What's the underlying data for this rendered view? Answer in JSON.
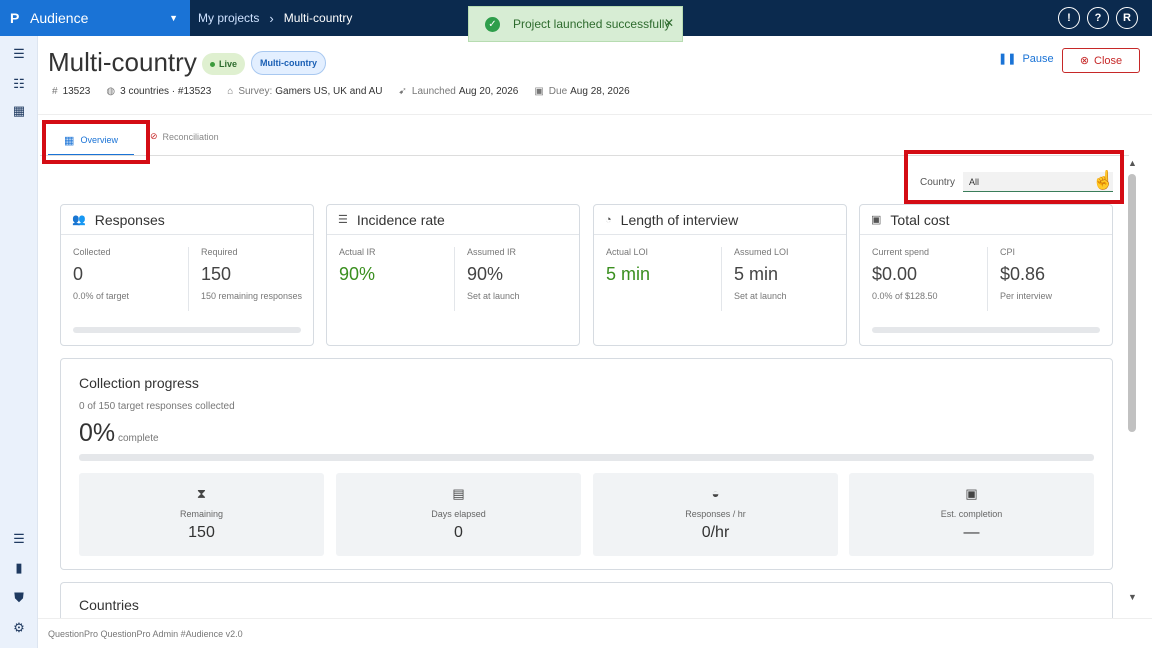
{
  "topbar": {
    "app_logo": "P",
    "app_name": "Audience",
    "breadcrumb": [
      "My projects",
      "Multi-country"
    ],
    "toast": "Project launched successfully",
    "icons": [
      "feedback-icon",
      "help-icon"
    ],
    "avatar_initial": "R"
  },
  "sidebar": {
    "icons": [
      "menu-icon",
      "list-icon",
      "dashboard-icon",
      "sliders-icon",
      "trash-icon",
      "shield-icon",
      "settings-icon"
    ]
  },
  "project": {
    "title": "Multi-country",
    "status": "Live",
    "tag": "Multi-country",
    "pause": "Pause",
    "close": "Close",
    "meta": {
      "id": "13523",
      "countries": "3 countries · #13523",
      "survey_label": "Survey:",
      "survey": "Gamers US, UK and AU",
      "launched_label": "Launched",
      "launched": "Aug 20, 2026",
      "due_label": "Due",
      "due": "Aug 28, 2026"
    }
  },
  "tabs": {
    "overview": "Overview",
    "reconciliation": "Reconciliation"
  },
  "filter": {
    "label": "Country",
    "value": "All"
  },
  "cards": {
    "responses": {
      "title": "Responses",
      "l_label": "Collected",
      "l_value": "0",
      "l_sub": "0.0% of target",
      "r_label": "Required",
      "r_value": "150",
      "r_sub": "150 remaining responses",
      "progress": 0
    },
    "incidence": {
      "title": "Incidence rate",
      "l_label": "Actual IR",
      "l_value": "90%",
      "r_label": "Assumed IR",
      "r_value": "90%",
      "r_sub": "Set at launch"
    },
    "loi": {
      "title": "Length of interview",
      "l_label": "Actual LOI",
      "l_value": "5 min",
      "r_label": "Assumed LOI",
      "r_value": "5 min",
      "r_sub": "Set at launch"
    },
    "cost": {
      "title": "Total cost",
      "l_label": "Current spend",
      "l_value": "$0.00",
      "l_sub": "0.0% of $128.50",
      "r_label": "CPI",
      "r_value": "$0.86",
      "r_sub": "Per interview",
      "progress": 0
    }
  },
  "collection": {
    "title": "Collection progress",
    "subtitle": "0 of 150 target responses collected",
    "percent": "0%",
    "complete": "complete",
    "progress": 0,
    "tiles": [
      {
        "label": "Remaining",
        "value": "150",
        "icon": "hourglass-icon"
      },
      {
        "label": "Days elapsed",
        "value": "0",
        "icon": "calendar-icon"
      },
      {
        "label": "Responses / hr",
        "value": "0/hr",
        "icon": "speedometer-icon"
      },
      {
        "label": "Est. completion",
        "value": "—",
        "icon": "calendar-check-icon"
      }
    ]
  },
  "countries_title": "Countries",
  "footer": "QuestionPro QuestionPro Admin  #Audience v2.0"
}
